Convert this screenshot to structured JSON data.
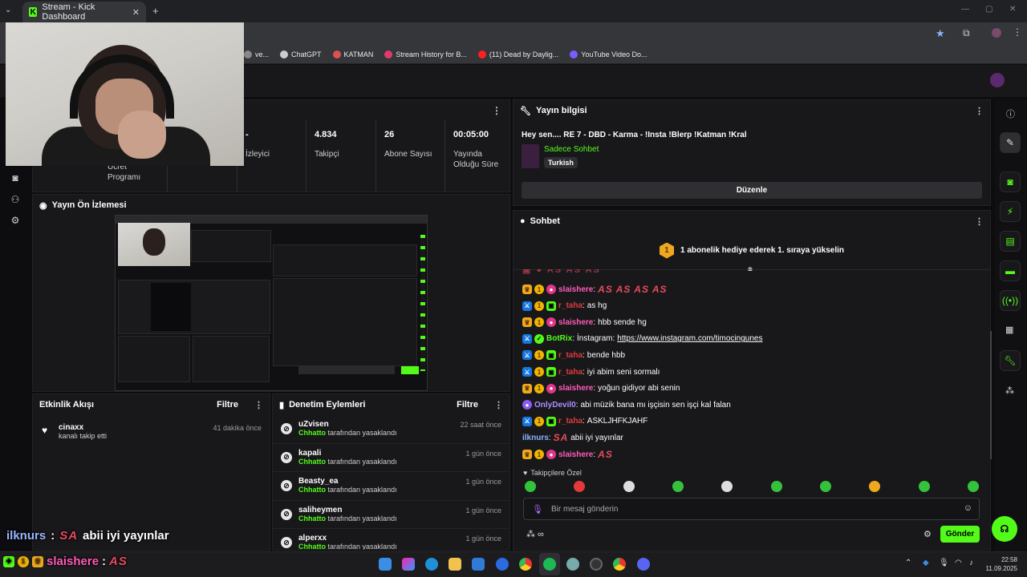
{
  "browser": {
    "tab_title": "Stream - Kick Dashboard",
    "new_tab": "+",
    "bookmarks": [
      {
        "label": "ve...",
        "color": "#888888"
      },
      {
        "label": "ChatGPT",
        "color": "#cccccc"
      },
      {
        "label": "KATMAN",
        "color": "#e05050"
      },
      {
        "label": "Stream History for B...",
        "color": "#e03a6b"
      },
      {
        "label": "(11) Dead by Daylig...",
        "color": "#ff2020"
      },
      {
        "label": "YouTube Video Do...",
        "color": "#7a5cff"
      }
    ]
  },
  "stats": {
    "panel_partial_label": "Ücret Programı",
    "viewers_value": "-",
    "viewers_label": "İzleyici",
    "followers_value": "4.834",
    "followers_label": "Takipçi",
    "subs_value": "26",
    "subs_label": "Abone Sayısı",
    "uptime_value": "00:05:00",
    "uptime_label": "Yayında Olduğu Süre"
  },
  "stream_info": {
    "title": "Yayın bilgisi",
    "stream_title": "Hey sen.... RE 7 - DBD - Karma - !Insta !Blerp !Katman !Kral",
    "chat_mode": "Sadece Sohbet",
    "language": "Turkish",
    "edit_button": "Düzenle"
  },
  "preview": {
    "title": "Yayın Ön İzlemesi"
  },
  "activity": {
    "title": "Etkinlik Akışı",
    "filter": "Filtre",
    "items": [
      {
        "user": "cinaxx",
        "action": "kanalı takip etti",
        "ago": "41 dakika önce"
      }
    ]
  },
  "moderation": {
    "title": "Denetim Eylemleri",
    "filter": "Filtre",
    "by": "Chhatto",
    "action": "tarafından yasaklandı",
    "items": [
      {
        "user": "uZvisen",
        "ago": "22 saat önce"
      },
      {
        "user": "kapali",
        "ago": "1 gün önce"
      },
      {
        "user": "Beasty_ea",
        "ago": "1 gün önce"
      },
      {
        "user": "saliheymen",
        "ago": "1 gün önce"
      },
      {
        "user": "alperxx",
        "ago": "1 gün önce"
      }
    ]
  },
  "chat": {
    "title": "Sohbet",
    "gift_num": "1",
    "gift_banner": "1 abonelik hediye ederek 1. sıraya yükselin",
    "followers_only": "Takipçilere Özel",
    "input_placeholder": "Bir mesaj gönderin",
    "send_button": "Gönder",
    "messages": [
      {
        "user": "slaishere",
        "sep": ":",
        "text": "AS AS AS AS",
        "style": "emote"
      },
      {
        "user": "r_taha",
        "sep": ":",
        "text": "as hg",
        "style": "plain"
      },
      {
        "user": "slaishere",
        "sep": ":",
        "text": "hbb sende hg",
        "style": "plain"
      },
      {
        "user": "BotRix",
        "sep": ":",
        "text": "İnstagram: ",
        "link": "https://www.instagram.com/timocingunes",
        "style": "plain"
      },
      {
        "user": "r_taha",
        "sep": ":",
        "text": "bende hbb",
        "style": "plain"
      },
      {
        "user": "r_taha",
        "sep": ":",
        "text": "iyi abim seni sormalı",
        "style": "plain"
      },
      {
        "user": "slaishere",
        "sep": ":",
        "text": "yoğun gidiyor abi senin",
        "style": "plain"
      },
      {
        "user": "OnlyDevil0",
        "sep": ":",
        "text": "abi müzik bana mı işçisin sen işçi kal falan",
        "style": "plain"
      },
      {
        "user": "r_taha",
        "sep": ":",
        "text": "ASKLJHFKJAHF",
        "style": "plain"
      },
      {
        "user": "ilknurs",
        "sep": ":",
        "emote": "SA",
        "text": "abii iyi yayınlar",
        "style": "plain"
      },
      {
        "user": "slaishere",
        "sep": ":",
        "text": "AS",
        "style": "emote"
      }
    ]
  },
  "overlay": {
    "line1_user": "ilknurs",
    "line1_sep": ":",
    "line1_emote": "SA",
    "line1_text": "abii iyi yayınlar",
    "line2_user": "slaishere",
    "line2_sep": ":",
    "line2_text": "AS"
  },
  "clock": {
    "time": "22:58",
    "date": "11.09.2025"
  }
}
